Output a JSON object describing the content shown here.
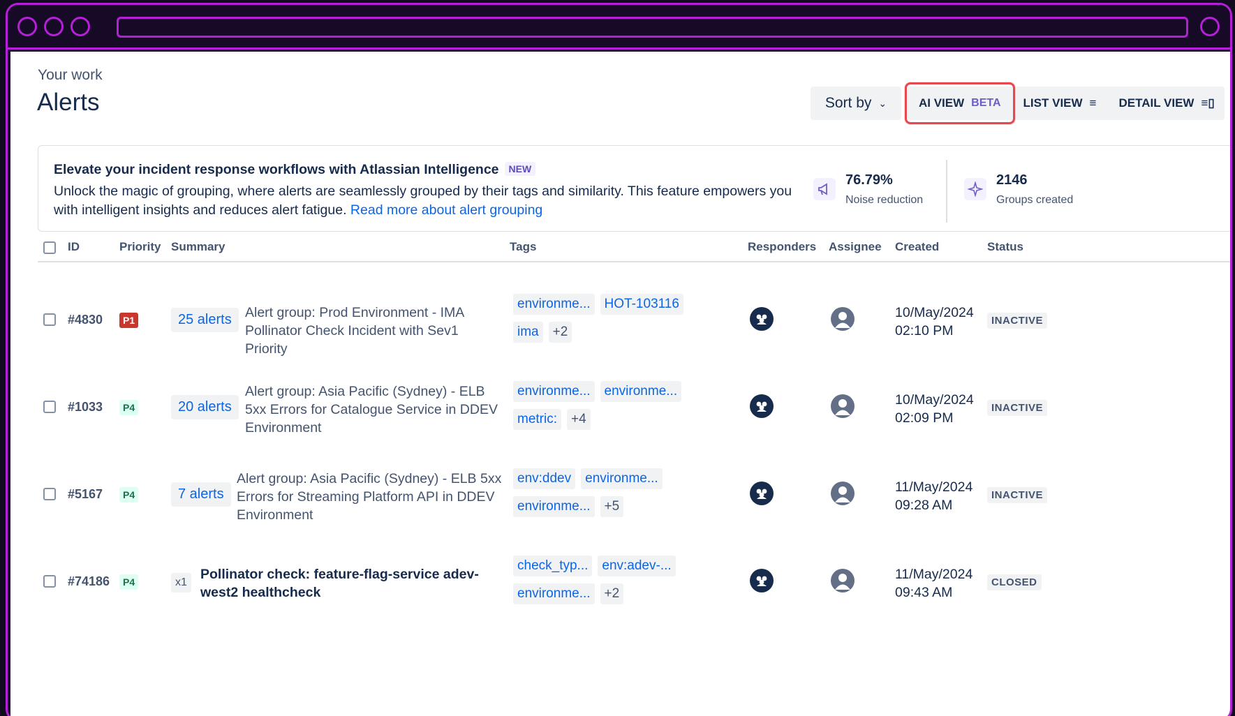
{
  "breadcrumb": "Your work",
  "title": "Alerts",
  "toolbar": {
    "sort_label": "Sort by",
    "ai_view": "AI VIEW",
    "ai_beta": "BETA",
    "list_view": "LIST VIEW",
    "detail_view": "DETAIL VIEW"
  },
  "banner": {
    "title": "Elevate your incident response workflows with Atlassian Intelligence",
    "new_badge": "NEW",
    "text": "Unlock the magic of grouping, where alerts are seamlessly grouped by their tags and similarity. This feature empowers you with intelligent insights and reduces alert fatigue.",
    "link": "Read more about alert grouping",
    "stats": [
      {
        "value": "76.79%",
        "label": "Noise reduction",
        "icon": "megaphone-icon"
      },
      {
        "value": "2146",
        "label": "Groups created",
        "icon": "sparkle-icon"
      }
    ]
  },
  "table": {
    "headers": {
      "id": "ID",
      "priority": "Priority",
      "summary": "Summary",
      "tags": "Tags",
      "responders": "Responders",
      "assignee": "Assignee",
      "created": "Created",
      "status": "Status"
    },
    "rows": [
      {
        "id": "#4830",
        "priority": "P1",
        "count": "25 alerts",
        "summary": "Alert group: Prod Environment - IMA Pollinator Check Incident with Sev1 Priority",
        "tags": [
          "environme...",
          "HOT-103116",
          "ima",
          "+2"
        ],
        "created_date": "10/May/2024",
        "created_time": "02:10 PM",
        "status": "INACTIVE"
      },
      {
        "id": "#1033",
        "priority": "P4",
        "count": "20 alerts",
        "summary": "Alert group: Asia Pacific (Sydney) - ELB 5xx Errors for Catalogue Service in DDEV Environment",
        "tags": [
          "environme...",
          "environme...",
          "metric:",
          "+4"
        ],
        "created_date": "10/May/2024",
        "created_time": "02:09 PM",
        "status": "INACTIVE"
      },
      {
        "id": "#5167",
        "priority": "P4",
        "count": "7 alerts",
        "summary": "Alert group: Asia Pacific (Sydney) - ELB 5xx Errors for Streaming Platform API in DDEV Environment",
        "tags": [
          "env:ddev",
          "environme...",
          "environme...",
          "+5"
        ],
        "created_date": "11/May/2024",
        "created_time": "09:28 AM",
        "status": "INACTIVE"
      },
      {
        "id": "#74186",
        "priority": "P4",
        "count": "x1",
        "summary": "Pollinator check: feature-flag-service adev-west2 healthcheck",
        "tags": [
          "check_typ...",
          "env:adev-...",
          "environme...",
          "+2"
        ],
        "created_date": "11/May/2024",
        "created_time": "09:43 AM",
        "status": "CLOSED"
      }
    ]
  }
}
